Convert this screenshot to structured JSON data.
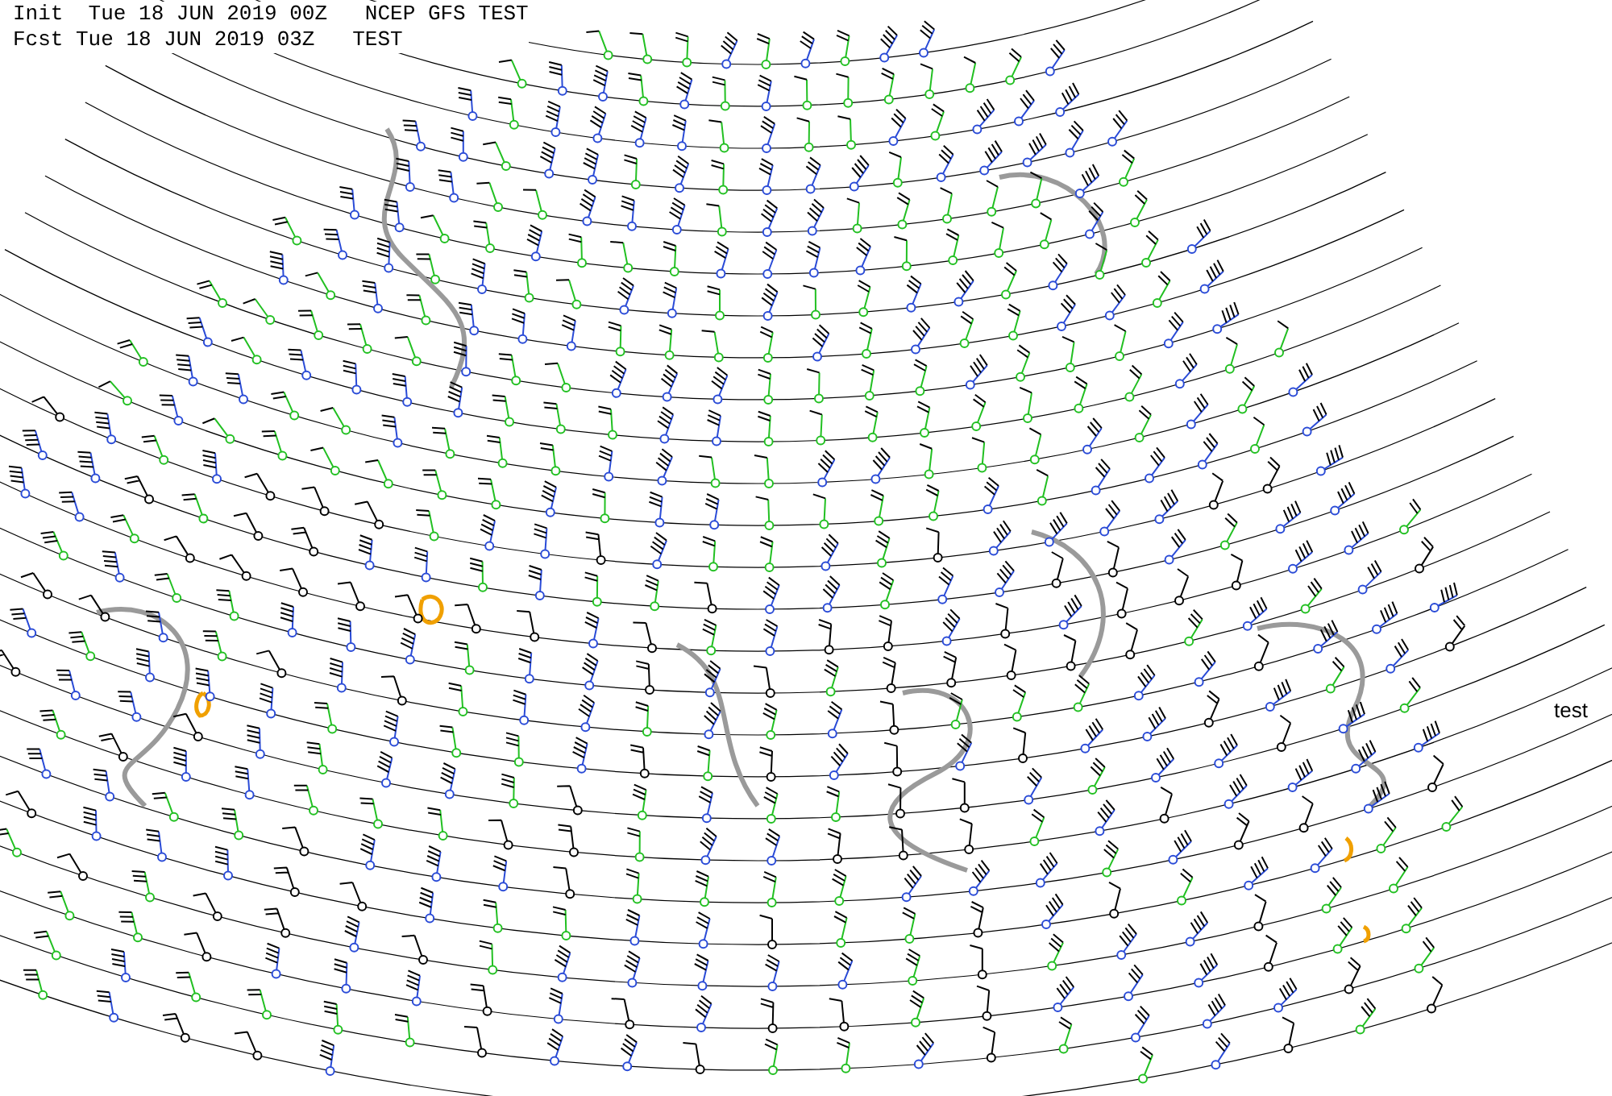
{
  "header": {
    "init_line": "Init  Tue 18 JUN 2019 00Z   NCEP GFS TEST",
    "fcst_line": "Fcst Tue 18 JUN 2019 03Z   TEST"
  },
  "legend_label": "test"
}
